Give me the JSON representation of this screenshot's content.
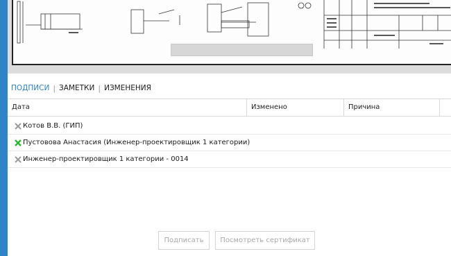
{
  "tabs": [
    "ПОДПИСИ",
    "ЗАМЕТКИ",
    "ИЗМЕНЕНИЯ"
  ],
  "columns": {
    "date": "Дата",
    "changed": "Изменено",
    "reason": "Причина"
  },
  "signers": [
    {
      "name": "Котов В.В. (ГИП)",
      "status": "not-signed",
      "mark_icon": "x-mark-icon",
      "mark_color": "#9a9a9a"
    },
    {
      "name": "Пустовова Анастасия (Инженер-проектировщик 1 категории)",
      "status": "signed",
      "mark_icon": "x-mark-icon",
      "mark_color": "#2fb52f"
    },
    {
      "name": "Инженер-проектировщик 1 категории - 0014",
      "status": "not-signed",
      "mark_icon": "x-mark-icon",
      "mark_color": "#9a9a9a"
    }
  ],
  "buttons": {
    "sign": "Подписать",
    "view_certificate": "Посмотреть сертификат"
  },
  "colors": {
    "accent": "#2f7fc0",
    "sidebar": "#2f84c8",
    "signed": "#2fb52f",
    "unsigned": "#9a9a9a"
  }
}
